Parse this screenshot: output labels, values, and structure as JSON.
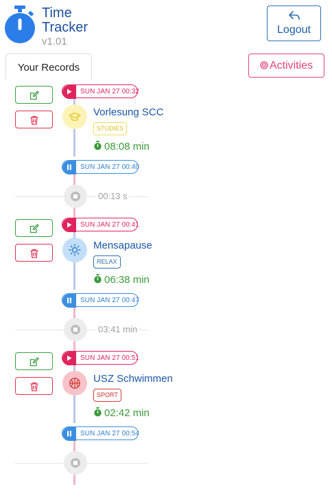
{
  "header": {
    "title": "Time Tracker",
    "version": "v1.01",
    "logout_label": "Logout",
    "logout_icon": "reply-arrow-icon"
  },
  "tabs": {
    "records_label": "Your Records",
    "activities_label": "Activities",
    "activities_icon": "target-icon"
  },
  "colors": {
    "brand": "#2b7de9",
    "start": "#e0245e",
    "stop": "#3b8fe0",
    "duration": "#3a9a3a"
  },
  "records": [
    {
      "start": "SUN JAN 27 00:32",
      "stop": "SUN JAN 27 00:40",
      "activity": "Vorlesung SCC",
      "category": "STUDIES",
      "category_icon": "graduation-cap-icon",
      "duration": "08:08 min"
    },
    {
      "start": "SUN JAN 27 00:41",
      "stop": "SUN JAN 27 00:47",
      "activity": "Mensapause",
      "category": "RELAX",
      "category_icon": "sun-icon",
      "duration": "06:38 min"
    },
    {
      "start": "SUN JAN 27 00:51",
      "stop": "SUN JAN 27 00:54",
      "activity": "USZ Schwimmen",
      "category": "SPORT",
      "category_icon": "basketball-icon",
      "duration": "02:42 min"
    }
  ],
  "gaps": [
    "00:13 s",
    "03:41 min",
    ""
  ]
}
